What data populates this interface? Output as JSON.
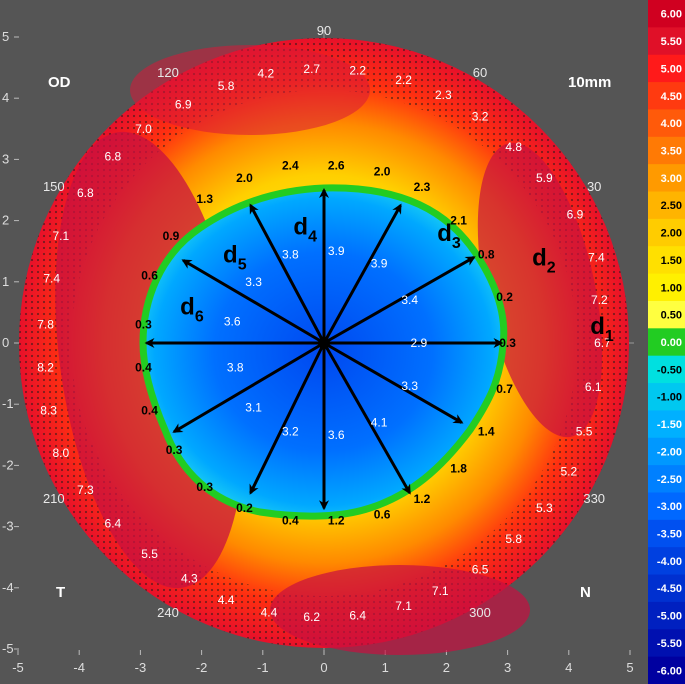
{
  "corners": {
    "eye": "OD",
    "scale": "10mm",
    "temporal": "T",
    "nasal": "N"
  },
  "angle_labels": [
    {
      "text": "90",
      "deg": 90
    },
    {
      "text": "60",
      "deg": 60
    },
    {
      "text": "30",
      "deg": 30
    },
    {
      "text": "120",
      "deg": 120
    },
    {
      "text": "150",
      "deg": 150
    },
    {
      "text": "210",
      "deg": 210
    },
    {
      "text": "240",
      "deg": 240
    },
    {
      "text": "300",
      "deg": 300
    },
    {
      "text": "330",
      "deg": 330
    }
  ],
  "x_ticks": [
    "-5",
    "-4",
    "-3",
    "-2",
    "-1",
    "0",
    "1",
    "2",
    "3",
    "4",
    "5"
  ],
  "y_ticks": [
    "5",
    "4",
    "3",
    "2",
    "1",
    "0",
    "-1",
    "-2",
    "-3",
    "-4",
    "-5"
  ],
  "scale_bar": [
    {
      "label": "6.00",
      "color": "#d00020"
    },
    {
      "label": "5.50",
      "color": "#e01028"
    },
    {
      "label": "5.00",
      "color": "#ff1a1a"
    },
    {
      "label": "4.50",
      "color": "#ff3a10"
    },
    {
      "label": "4.00",
      "color": "#ff5a0a"
    },
    {
      "label": "3.50",
      "color": "#ff7a05"
    },
    {
      "label": "3.00",
      "color": "#ff9a00"
    },
    {
      "label": "2.50",
      "color": "#ffb400"
    },
    {
      "label": "2.00",
      "color": "#ffcc00"
    },
    {
      "label": "1.50",
      "color": "#ffe000"
    },
    {
      "label": "1.00",
      "color": "#fff000"
    },
    {
      "label": "0.50",
      "color": "#ffff40"
    },
    {
      "label": "0.00",
      "color": "#22cc22"
    },
    {
      "label": "-0.50",
      "color": "#00e0e0"
    },
    {
      "label": "-1.00",
      "color": "#00c8f0"
    },
    {
      "label": "-1.50",
      "color": "#00b0ff"
    },
    {
      "label": "-2.00",
      "color": "#0098ff"
    },
    {
      "label": "-2.50",
      "color": "#0080ff"
    },
    {
      "label": "-3.00",
      "color": "#0068ff"
    },
    {
      "label": "-3.50",
      "color": "#0050f0"
    },
    {
      "label": "-4.00",
      "color": "#0040e0"
    },
    {
      "label": "-4.50",
      "color": "#0030d0"
    },
    {
      "label": "-5.00",
      "color": "#0020c0"
    },
    {
      "label": "-5.50",
      "color": "#0010b0"
    },
    {
      "label": "-6.00",
      "color": "#0000a0"
    }
  ],
  "dist_labels": [
    {
      "text": "d",
      "sub": "1",
      "x": 4.35,
      "y": 0.28
    },
    {
      "text": "d",
      "sub": "2",
      "x": 3.4,
      "y": 1.4
    },
    {
      "text": "d",
      "sub": "3",
      "x": 1.85,
      "y": 1.8
    },
    {
      "text": "d",
      "sub": "4",
      "x": -0.5,
      "y": 1.9
    },
    {
      "text": "d",
      "sub": "5",
      "x": -1.65,
      "y": 1.45
    },
    {
      "text": "d",
      "sub": "6",
      "x": -2.35,
      "y": 0.6
    }
  ],
  "values": [
    {
      "t": "2.7",
      "x": -0.2,
      "y": 4.48
    },
    {
      "t": "2.2",
      "x": 0.55,
      "y": 4.45
    },
    {
      "t": "2.2",
      "x": 1.3,
      "y": 4.3
    },
    {
      "t": "4.2",
      "x": -0.95,
      "y": 4.4
    },
    {
      "t": "2.3",
      "x": 1.95,
      "y": 4.05
    },
    {
      "t": "3.2",
      "x": 2.55,
      "y": 3.7
    },
    {
      "t": "4.8",
      "x": 3.1,
      "y": 3.2
    },
    {
      "t": "5.9",
      "x": 3.6,
      "y": 2.7
    },
    {
      "t": "6.9",
      "x": 4.1,
      "y": 2.1
    },
    {
      "t": "7.4",
      "x": 4.45,
      "y": 1.4
    },
    {
      "t": "7.2",
      "x": 4.5,
      "y": 0.7
    },
    {
      "t": "6.7",
      "x": 4.55,
      "y": 0.0
    },
    {
      "t": "6.1",
      "x": 4.4,
      "y": -0.72
    },
    {
      "t": "5.5",
      "x": 4.25,
      "y": -1.45
    },
    {
      "t": "5.2",
      "x": 4.0,
      "y": -2.1
    },
    {
      "t": "5.3",
      "x": 3.6,
      "y": -2.7
    },
    {
      "t": "5.8",
      "x": 3.1,
      "y": -3.2
    },
    {
      "t": "6.5",
      "x": 2.55,
      "y": -3.7
    },
    {
      "t": "7.1",
      "x": 1.9,
      "y": -4.05
    },
    {
      "t": "7.1",
      "x": 1.3,
      "y": -4.3
    },
    {
      "t": "6.4",
      "x": 0.55,
      "y": -4.45
    },
    {
      "t": "6.2",
      "x": -0.2,
      "y": -4.48
    },
    {
      "t": "4.4",
      "x": -0.9,
      "y": -4.4
    },
    {
      "t": "4.4",
      "x": -1.6,
      "y": -4.2
    },
    {
      "t": "4.3",
      "x": -2.2,
      "y": -3.85
    },
    {
      "t": "5.5",
      "x": -2.85,
      "y": -3.45
    },
    {
      "t": "6.4",
      "x": -3.45,
      "y": -2.95
    },
    {
      "t": "7.3",
      "x": -3.9,
      "y": -2.4
    },
    {
      "t": "8.0",
      "x": -4.3,
      "y": -1.8
    },
    {
      "t": "8.3",
      "x": -4.5,
      "y": -1.1
    },
    {
      "t": "8.2",
      "x": -4.55,
      "y": -0.4
    },
    {
      "t": "7.8",
      "x": -4.55,
      "y": 0.3
    },
    {
      "t": "7.4",
      "x": -4.45,
      "y": 1.05
    },
    {
      "t": "7.1",
      "x": -4.3,
      "y": 1.75
    },
    {
      "t": "6.8",
      "x": -3.9,
      "y": 2.45
    },
    {
      "t": "6.8",
      "x": -3.45,
      "y": 3.05
    },
    {
      "t": "7.0",
      "x": -2.95,
      "y": 3.5
    },
    {
      "t": "6.9",
      "x": -2.3,
      "y": 3.9
    },
    {
      "t": "5.8",
      "x": -1.6,
      "y": 4.2
    },
    {
      "t": "2.6",
      "x": 0.2,
      "y": 2.9
    },
    {
      "t": "2.0",
      "x": 0.95,
      "y": 2.8
    },
    {
      "t": "2.3",
      "x": 1.6,
      "y": 2.55
    },
    {
      "t": "2.1",
      "x": 2.2,
      "y": 2.0
    },
    {
      "t": "0.8",
      "x": 2.65,
      "y": 1.45
    },
    {
      "t": "0.2",
      "x": 2.95,
      "y": 0.75
    },
    {
      "t": "0.3",
      "x": 3.0,
      "y": 0.0
    },
    {
      "t": "0.7",
      "x": 2.95,
      "y": -0.75
    },
    {
      "t": "1.4",
      "x": 2.65,
      "y": -1.45
    },
    {
      "t": "1.8",
      "x": 2.2,
      "y": -2.05
    },
    {
      "t": "1.2",
      "x": 1.6,
      "y": -2.55
    },
    {
      "t": "0.6",
      "x": 0.95,
      "y": -2.8
    },
    {
      "t": "1.2",
      "x": 0.2,
      "y": -2.9
    },
    {
      "t": "0.4",
      "x": -0.55,
      "y": -2.9
    },
    {
      "t": "0.2",
      "x": -1.3,
      "y": -2.7
    },
    {
      "t": "0.3",
      "x": -1.95,
      "y": -2.35
    },
    {
      "t": "0.3",
      "x": -2.45,
      "y": -1.75
    },
    {
      "t": "0.4",
      "x": -2.85,
      "y": -1.1
    },
    {
      "t": "0.4",
      "x": -2.95,
      "y": -0.4
    },
    {
      "t": "0.3",
      "x": -2.95,
      "y": 0.3
    },
    {
      "t": "0.6",
      "x": -2.85,
      "y": 1.1
    },
    {
      "t": "0.9",
      "x": -2.5,
      "y": 1.75
    },
    {
      "t": "1.3",
      "x": -1.95,
      "y": 2.35
    },
    {
      "t": "2.0",
      "x": -1.3,
      "y": 2.7
    },
    {
      "t": "2.4",
      "x": -0.55,
      "y": 2.9
    },
    {
      "t": "3.9",
      "x": 0.2,
      "y": 1.5
    },
    {
      "t": "3.9",
      "x": 0.9,
      "y": 1.3
    },
    {
      "t": "3.4",
      "x": 1.4,
      "y": 0.7
    },
    {
      "t": "2.9",
      "x": 1.55,
      "y": 0.0
    },
    {
      "t": "3.3",
      "x": 1.4,
      "y": -0.7
    },
    {
      "t": "4.1",
      "x": 0.9,
      "y": -1.3
    },
    {
      "t": "3.6",
      "x": 0.2,
      "y": -1.5
    },
    {
      "t": "3.2",
      "x": -0.55,
      "y": -1.45
    },
    {
      "t": "3.1",
      "x": -1.15,
      "y": -1.05
    },
    {
      "t": "3.8",
      "x": -1.45,
      "y": -0.4
    },
    {
      "t": "3.6",
      "x": -1.5,
      "y": 0.35
    },
    {
      "t": "3.3",
      "x": -1.15,
      "y": 1.0
    },
    {
      "t": "3.8",
      "x": -0.55,
      "y": 1.45
    }
  ],
  "arrows": [
    {
      "x": 2.9,
      "y": 0.0
    },
    {
      "x": 2.45,
      "y": 1.4
    },
    {
      "x": 1.25,
      "y": 2.25
    },
    {
      "x": 0.0,
      "y": 2.5
    },
    {
      "x": -1.2,
      "y": 2.25
    },
    {
      "x": -2.3,
      "y": 1.35
    },
    {
      "x": -2.9,
      "y": 0.0
    },
    {
      "x": -2.45,
      "y": -1.45
    },
    {
      "x": -1.2,
      "y": -2.45
    },
    {
      "x": 0.0,
      "y": -2.7
    },
    {
      "x": 1.4,
      "y": -2.45
    },
    {
      "x": 2.25,
      "y": -1.3
    }
  ]
}
